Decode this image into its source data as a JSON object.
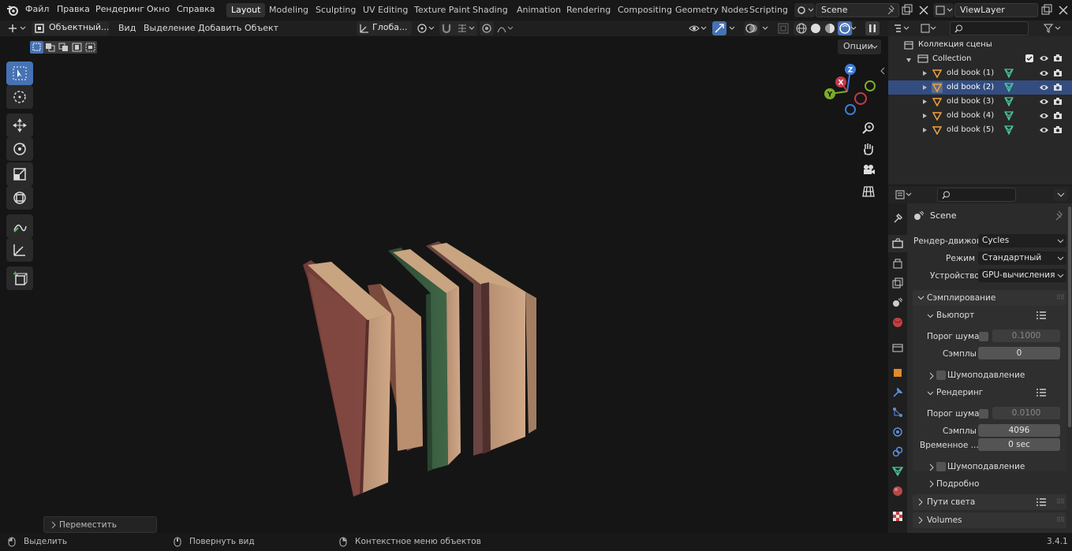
{
  "menubar": {
    "items": [
      "Файл",
      "Правка",
      "Рендеринг",
      "Окно",
      "Справка"
    ],
    "workspaces": [
      "Layout",
      "Modeling",
      "Sculpting",
      "UV Editing",
      "Texture Paint",
      "Shading",
      "Animation",
      "Rendering",
      "Compositing",
      "Geometry Nodes",
      "Scripting"
    ],
    "active_workspace": "Layout",
    "scene": "Scene",
    "view_layer": "ViewLayer"
  },
  "viewport_header": {
    "mode": "Объектный...",
    "menus": [
      "Вид",
      "Выделение",
      "Добавить",
      "Объект"
    ],
    "orientation": "Глоба...",
    "options": "Опции"
  },
  "viewport": {
    "last_operator": "Переместить",
    "gizmo_axes": [
      "Z",
      "X",
      "Y"
    ]
  },
  "outliner": {
    "root": "Коллекция сцены",
    "collection": "Collection",
    "objects": [
      "old book (1)",
      "old book (2)",
      "old book (3)",
      "old book (4)",
      "old book (5)"
    ],
    "selected_index": 1
  },
  "properties": {
    "context": "Scene",
    "render_engine_label": "Рендер-движок",
    "render_engine": "Cycles",
    "mode_label": "Режим",
    "mode": "Стандартный",
    "device_label": "Устройство",
    "device": "GPU-вычисления",
    "sampling": "Сэмплирование",
    "viewport": "Вьюпорт",
    "noise_threshold_label": "Порог шума",
    "viewport_noise_threshold": "0.1000",
    "samples_label": "Сэмплы",
    "viewport_samples": "0",
    "denoise_label": "Шумоподавление",
    "render": "Рендеринг",
    "render_noise_threshold": "0.0100",
    "render_samples": "4096",
    "time_limit_label": "Временное ...",
    "time_limit": "0 sec",
    "advanced": "Подробно",
    "light_paths": "Пути света",
    "volumes": "Volumes"
  },
  "statusbar": {
    "select": "Выделить",
    "rotate_view": "Повернуть вид",
    "context_menu": "Контекстное меню объектов",
    "version": "3.4.1"
  },
  "colors": {
    "accent": "#4772b3",
    "selected_row": "#334d80",
    "axis_x": "#c43a4a",
    "axis_y": "#7bad26",
    "axis_z": "#3f7ad6"
  }
}
